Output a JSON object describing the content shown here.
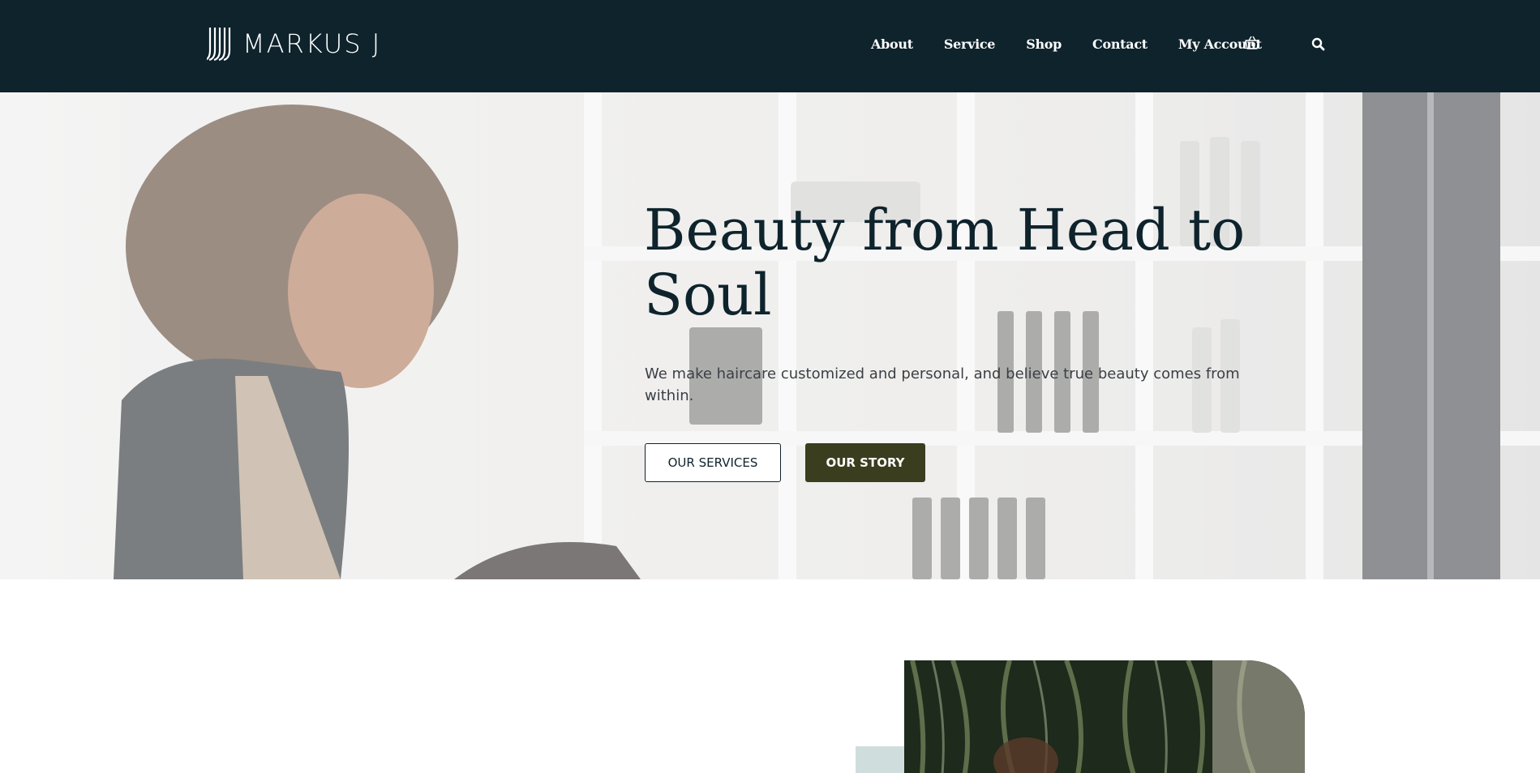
{
  "brand": {
    "name": "MARKUS J",
    "logo_icon": "stacked-lines-logo-icon"
  },
  "nav": {
    "items": [
      {
        "label": "About"
      },
      {
        "label": "Service"
      },
      {
        "label": "Shop"
      },
      {
        "label": "Contact"
      },
      {
        "label": "My Account"
      }
    ],
    "cart_icon": "basket-icon",
    "search_icon": "search-icon"
  },
  "hero": {
    "title": "Beauty from Head to Soul",
    "subtitle": "We make haircare customized and personal, and believe true beauty comes from within.",
    "primary_button": "OUR SERVICES",
    "secondary_button": "OUR STORY"
  },
  "colors": {
    "header_bg": "#0e232c",
    "title_text": "#0e232c",
    "accent_button": "#3a3e1e",
    "accent_block": "#cfdedd"
  }
}
